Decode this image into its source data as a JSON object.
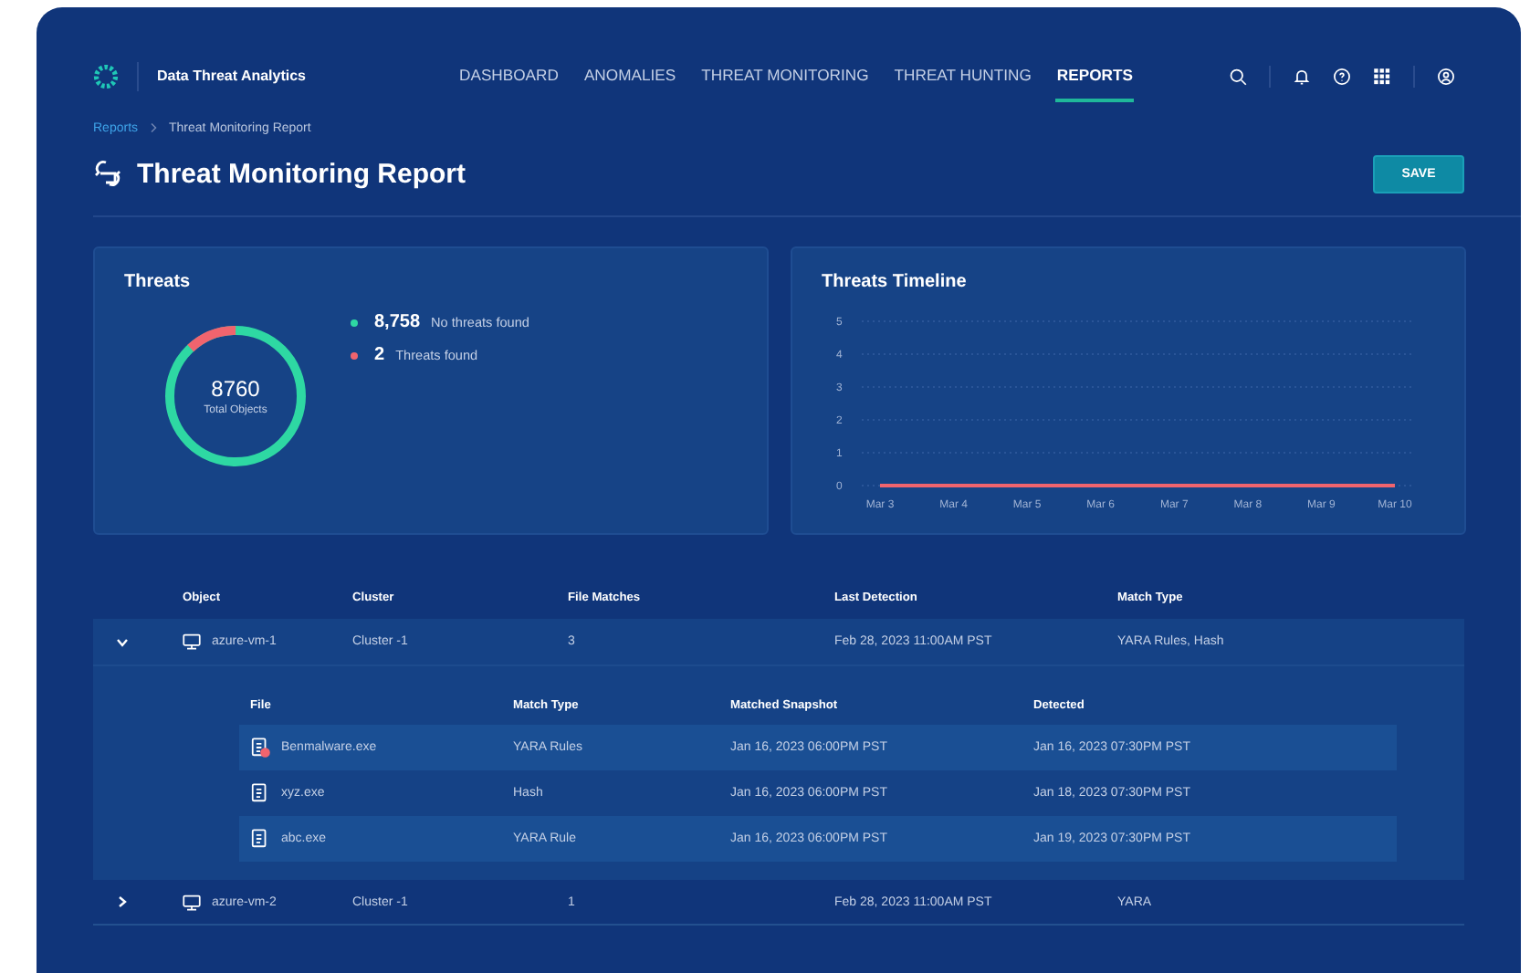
{
  "app": {
    "name": "Data Threat Analytics"
  },
  "nav": [
    {
      "label": "DASHBOARD",
      "selected": false
    },
    {
      "label": "ANOMALIES",
      "selected": false
    },
    {
      "label": "THREAT MONITORING",
      "selected": false
    },
    {
      "label": "THREAT HUNTING",
      "selected": false
    },
    {
      "label": "REPORTS",
      "selected": true
    }
  ],
  "breadcrumb": [
    "Reports",
    "Threat Monitoring Report"
  ],
  "page": {
    "title": "Threat Monitoring Report",
    "save_button": "SAVE"
  },
  "threats": {
    "title": "Threats",
    "total": "8760",
    "total_label": "Total Objects",
    "legend": [
      {
        "count": "8,758",
        "label": "No threats found",
        "color": "#2ed8a3"
      },
      {
        "count": "2",
        "label": "Threats found",
        "color": "#f0646e"
      }
    ]
  },
  "timeline": {
    "title": "Threats Timeline",
    "chart_data": {
      "type": "line",
      "categories": [
        "Mar 3",
        "Mar 4",
        "Mar 5",
        "Mar 6",
        "Mar 7",
        "Mar 8",
        "Mar 9",
        "Mar 10"
      ],
      "ylim": [
        0,
        5
      ],
      "grid": true,
      "yticks": [
        0,
        1,
        2,
        3,
        4,
        5
      ],
      "series": [
        {
          "color": "#f0646e",
          "values": [
            0,
            0,
            0,
            0,
            0,
            0,
            0,
            0
          ]
        }
      ]
    }
  },
  "table": {
    "columns": [
      "Object",
      "Cluster",
      "File Matches",
      "Last Detection",
      "Match Type"
    ],
    "file_columns": [
      "File",
      "Match Type",
      "Matched Snapshot",
      "Detected"
    ],
    "rows": [
      {
        "object": "azure-vm-1",
        "cluster": "Cluster -1",
        "file_matches": "3",
        "last_detection": "Feb 28, 2023 11:00AM PST",
        "match_type": "YARA Rules, Hash",
        "expanded": true,
        "files": [
          {
            "file": "Benmalware.exe",
            "flagged": true,
            "match_type": "YARA Rules",
            "snapshot": "Jan 16, 2023 06:00PM PST",
            "detected": "Jan 16, 2023 07:30PM PST"
          },
          {
            "file": "xyz.exe",
            "flagged": false,
            "match_type": "Hash",
            "snapshot": "Jan 16, 2023 06:00PM PST",
            "detected": "Jan 18, 2023 07:30PM PST"
          },
          {
            "file": "abc.exe",
            "flagged": false,
            "match_type": "YARA Rule",
            "snapshot": "Jan 16, 2023 06:00PM PST",
            "detected": "Jan 19, 2023 07:30PM PST"
          }
        ]
      },
      {
        "object": "azure-vm-2",
        "cluster": "Cluster -1",
        "file_matches": "1",
        "last_detection": "Feb 28, 2023 11:00AM PST",
        "match_type": "YARA",
        "expanded": false
      }
    ]
  }
}
